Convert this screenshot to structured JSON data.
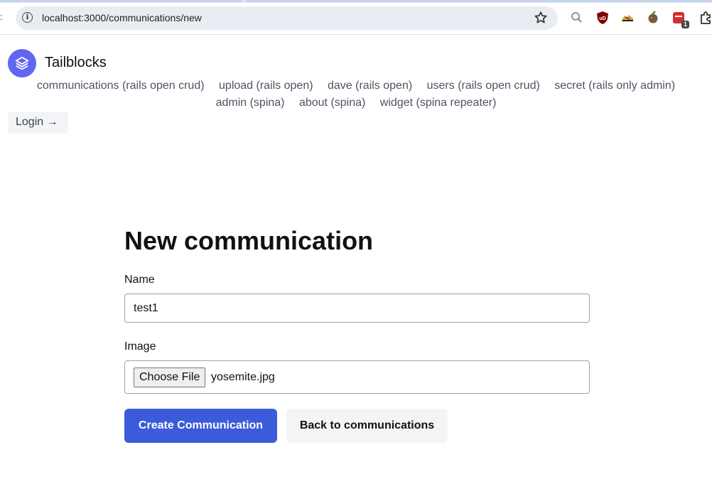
{
  "browser": {
    "url": "localhost:3000/communications/new",
    "extensions": [
      {
        "icon": "search-lens-icon"
      },
      {
        "icon": "ublock-shield-icon",
        "label": "uD"
      },
      {
        "icon": "sneaker-icon"
      },
      {
        "icon": "coconut-icon"
      },
      {
        "icon": "todo-list-icon",
        "badge": "1"
      },
      {
        "icon": "puzzle-extensions-icon"
      }
    ]
  },
  "site": {
    "brand": "Tailblocks",
    "nav_row1": [
      "communications (rails open crud)",
      "upload (rails open)",
      "dave (rails open)",
      "users (rails open crud)",
      "secret (rails only admin)"
    ],
    "nav_row2": [
      "admin (spina)",
      "about (spina)",
      "widget (spina repeater)"
    ],
    "login_label": "Login →"
  },
  "form": {
    "title": "New communication",
    "name_label": "Name",
    "name_value": "test1",
    "image_label": "Image",
    "choose_file_label": "Choose File",
    "file_name": "yosemite.jpg",
    "submit_label": "Create Communication",
    "back_label": "Back to communications"
  },
  "colors": {
    "accent": "#6366f1",
    "primary_button": "#3b5bdb",
    "secondary_button": "#f3f4f6"
  }
}
